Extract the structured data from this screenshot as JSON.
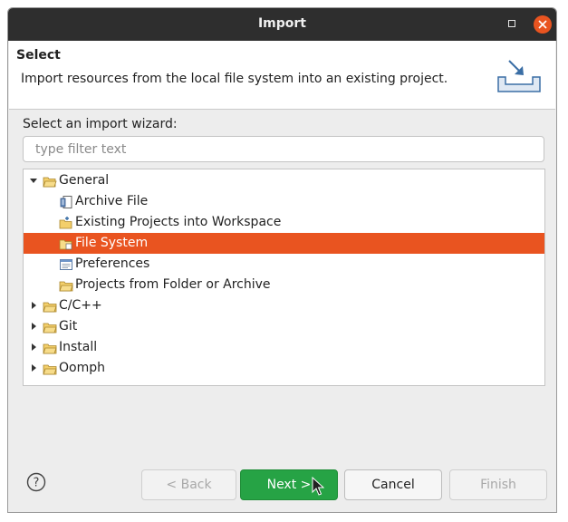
{
  "window": {
    "title": "Import"
  },
  "header": {
    "title": "Select",
    "description": "Import resources from the local file system into an existing project."
  },
  "wizard": {
    "label": "Select an import wizard:",
    "filter_placeholder": "type filter text",
    "filter_value": ""
  },
  "tree": {
    "items": [
      {
        "label": "General",
        "expanded": true,
        "level": 0,
        "icon": "folder-open-icon"
      },
      {
        "label": "Archive File",
        "level": 1,
        "icon": "archive-file-icon"
      },
      {
        "label": "Existing Projects into Workspace",
        "level": 1,
        "icon": "existing-projects-icon"
      },
      {
        "label": "File System",
        "level": 1,
        "icon": "file-system-icon",
        "selected": true
      },
      {
        "label": "Preferences",
        "level": 1,
        "icon": "preferences-icon"
      },
      {
        "label": "Projects from Folder or Archive",
        "level": 1,
        "icon": "projects-folder-icon"
      },
      {
        "label": "C/C++",
        "expanded": false,
        "level": 0,
        "icon": "folder-icon"
      },
      {
        "label": "Git",
        "expanded": false,
        "level": 0,
        "icon": "folder-icon"
      },
      {
        "label": "Install",
        "expanded": false,
        "level": 0,
        "icon": "folder-icon"
      },
      {
        "label": "Oomph",
        "expanded": false,
        "level": 0,
        "icon": "folder-icon"
      }
    ]
  },
  "buttons": {
    "back": "< Back",
    "next": "Next >",
    "cancel": "Cancel",
    "finish": "Finish"
  },
  "colors": {
    "accent": "#e95420",
    "primary_button": "#26a345",
    "titlebar": "#2e2e2e"
  }
}
